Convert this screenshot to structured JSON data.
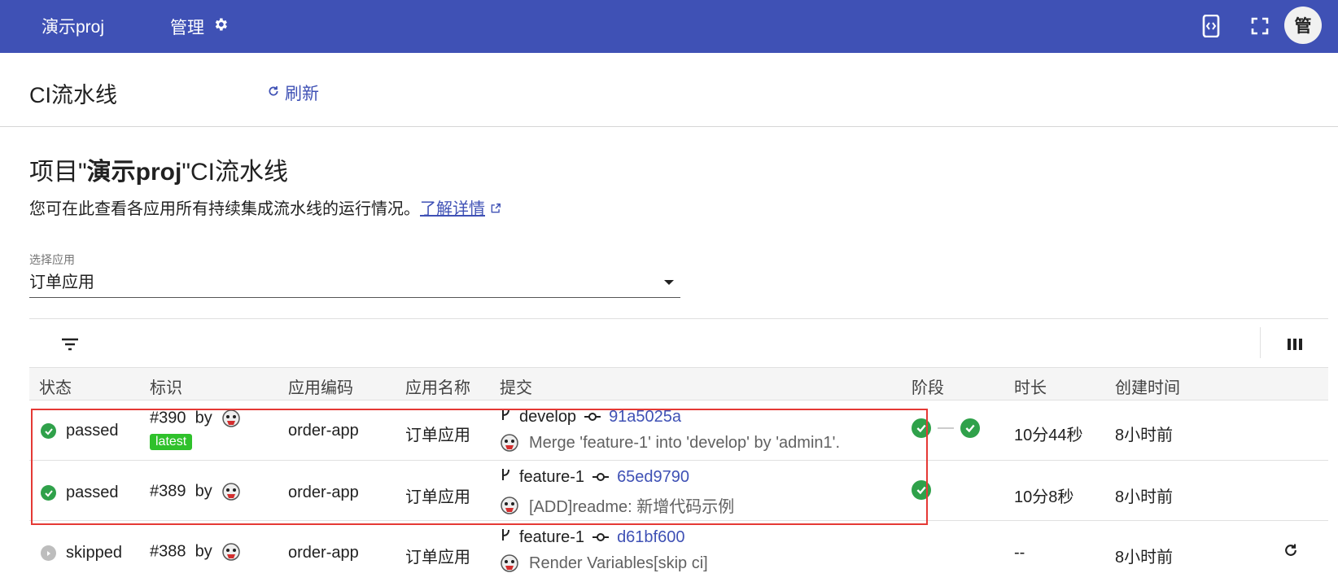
{
  "topbar": {
    "project": "演示proj",
    "manage": "管理",
    "avatar_text": "管",
    "bg_color": "#3f51b5"
  },
  "subheader": {
    "title": "CI流水线",
    "refresh": "刷新"
  },
  "page": {
    "heading_prefix": "项目\"",
    "heading_project": "演示proj",
    "heading_suffix": "\"CI流水线",
    "description": "您可在此查看各应用所有持续集成流水线的运行情况。",
    "learn_more": "了解详情"
  },
  "select": {
    "label": "选择应用",
    "value": "订单应用"
  },
  "table": {
    "headers": [
      "状态",
      "标识",
      "应用编码",
      "应用名称",
      "提交",
      "阶段",
      "时长",
      "创建时间"
    ],
    "rows": [
      {
        "status": "passed",
        "id": "#390",
        "by": "by",
        "tag": "latest",
        "app_code": "order-app",
        "app_name": "订单应用",
        "branch": "develop",
        "sha": "91a5025a",
        "message": "Merge 'feature-1' into 'develop' by 'admin1'.",
        "stages": [
          "passed",
          "passed"
        ],
        "duration": "10分44秒",
        "created": "8小时前"
      },
      {
        "status": "passed",
        "id": "#389",
        "by": "by",
        "tag": "",
        "app_code": "order-app",
        "app_name": "订单应用",
        "branch": "feature-1",
        "sha": "65ed9790",
        "message": "[ADD]readme: 新增代码示例",
        "stages": [
          "passed"
        ],
        "duration": "10分8秒",
        "created": "8小时前"
      },
      {
        "status": "skipped",
        "id": "#388",
        "by": "by",
        "tag": "",
        "app_code": "order-app",
        "app_name": "订单应用",
        "branch": "feature-1",
        "sha": "d61bf600",
        "message": "Render Variables[skip ci]",
        "stages": [],
        "duration": "--",
        "created": "8小时前"
      }
    ]
  },
  "colors": {
    "primary": "#3f51b5",
    "success": "#2fa14a",
    "latest_tag": "#2fc12b",
    "highlight": "#e53935"
  }
}
